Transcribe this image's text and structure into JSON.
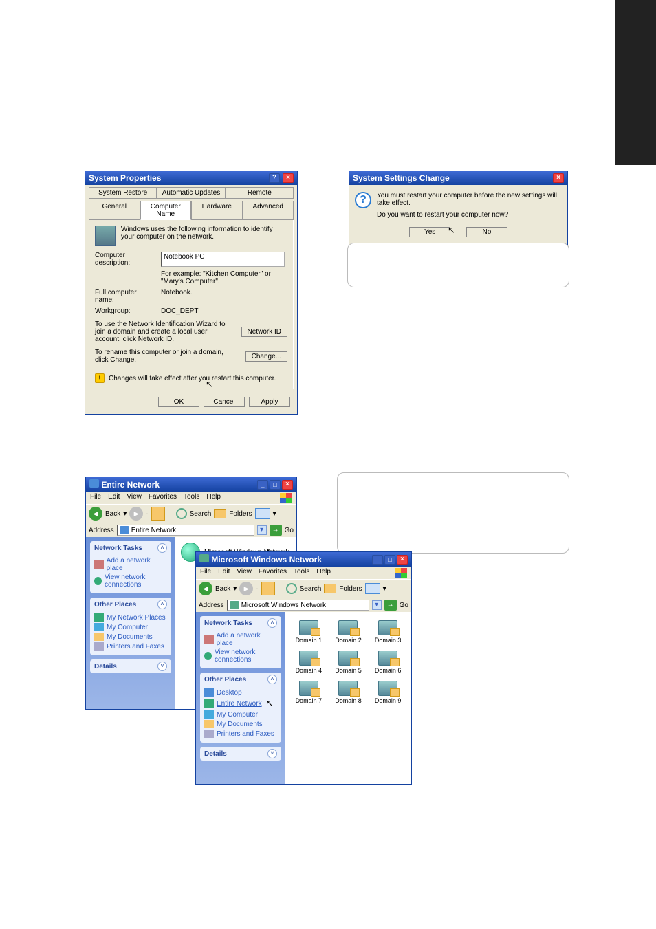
{
  "sysprop": {
    "title": "System Properties",
    "tabs_row1": [
      "System Restore",
      "Automatic Updates",
      "Remote"
    ],
    "tabs_row2": [
      "General",
      "Computer Name",
      "Hardware",
      "Advanced"
    ],
    "intro": "Windows uses the following information to identify your computer on the network.",
    "desc_label": "Computer description:",
    "desc_value": "Notebook PC",
    "desc_example": "For example: \"Kitchen Computer\" or \"Mary's Computer\".",
    "fullname_label": "Full computer name:",
    "fullname_value": "Notebook.",
    "workgroup_label": "Workgroup:",
    "workgroup_value": "DOC_DEPT",
    "netid_text": "To use the Network Identification Wizard to join a domain and create a local user account, click Network ID.",
    "netid_btn": "Network ID",
    "change_text": "To rename this computer or join a domain, click Change.",
    "change_btn": "Change...",
    "warn_text": "Changes will take effect after you restart this computer.",
    "ok": "OK",
    "cancel": "Cancel",
    "apply": "Apply"
  },
  "msgbox": {
    "title": "System Settings Change",
    "line1": "You must restart your computer before the new settings will take effect.",
    "line2": "Do you want to restart your computer now?",
    "yes": "Yes",
    "no": "No"
  },
  "exp1": {
    "title": "Entire Network",
    "menus": [
      "File",
      "Edit",
      "View",
      "Favorites",
      "Tools",
      "Help"
    ],
    "back": "Back",
    "search": "Search",
    "folders": "Folders",
    "address_label": "Address",
    "address_value": "Entire Network",
    "go": "Go",
    "network_tasks": "Network Tasks",
    "nt_items": [
      "Add a network place",
      "View network connections"
    ],
    "other_places": "Other Places",
    "op_items": [
      "My Network Places",
      "My Computer",
      "My Documents",
      "Printers and Faxes"
    ],
    "details": "Details",
    "content_item": "Microsoft Windows Network"
  },
  "exp2": {
    "title": "Microsoft Windows Network",
    "menus": [
      "File",
      "Edit",
      "View",
      "Favorites",
      "Tools",
      "Help"
    ],
    "back": "Back",
    "search": "Search",
    "folders": "Folders",
    "address_label": "Address",
    "address_value": "Microsoft Windows Network",
    "go": "Go",
    "network_tasks": "Network Tasks",
    "nt_items": [
      "Add a network place",
      "View network connections"
    ],
    "other_places": "Other Places",
    "op_items": [
      "Desktop",
      "Entire Network",
      "My Computer",
      "My Documents",
      "Printers and Faxes"
    ],
    "details": "Details",
    "domains": [
      "Domain 1",
      "Domain 2",
      "Domain 3",
      "Domain 4",
      "Domain 5",
      "Domain 6",
      "Domain 7",
      "Domain 8",
      "Domain 9"
    ]
  }
}
